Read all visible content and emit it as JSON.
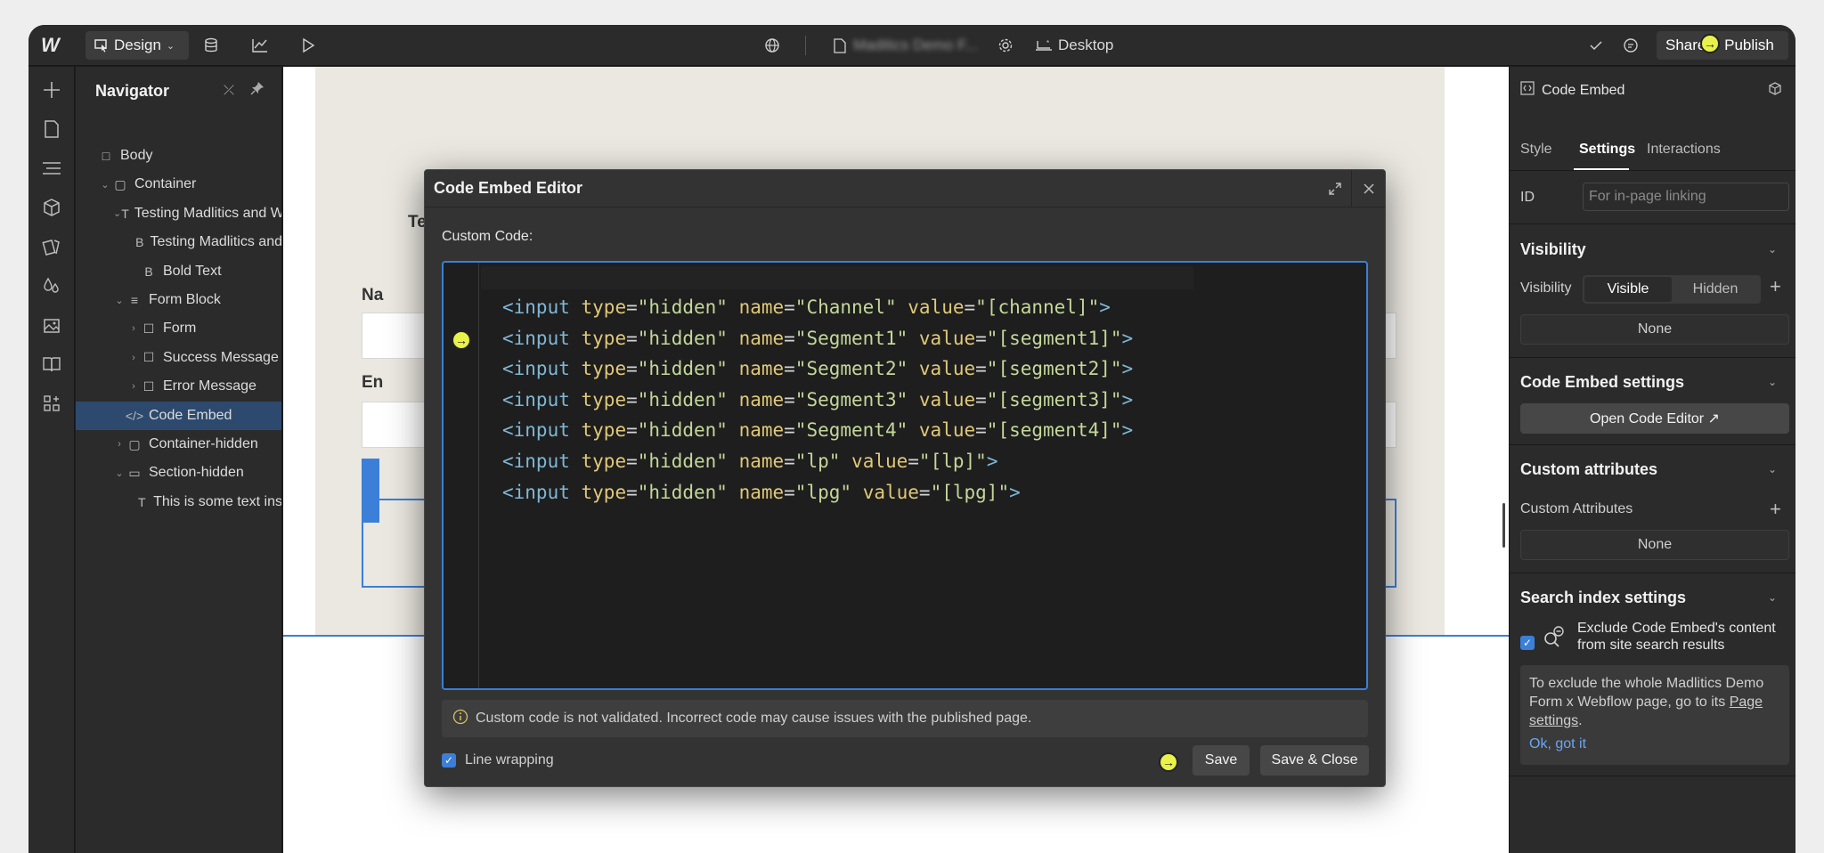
{
  "topbar": {
    "logo": "W",
    "mode_label": "Design",
    "page_name": "Maditics Demo F...",
    "device_label": "Desktop",
    "share_label": "Share",
    "publish_label": "Publish"
  },
  "navigator": {
    "title": "Navigator",
    "items": [
      {
        "label": "Body",
        "icon": "□",
        "indent": 0,
        "chevron": ""
      },
      {
        "label": "Container",
        "icon": "▢",
        "indent": 1,
        "chevron": "⌄"
      },
      {
        "label": "Testing Madlitics and W",
        "icon": "T",
        "indent": 2,
        "chevron": "⌄"
      },
      {
        "label": "Testing Madlitics and",
        "icon": "B",
        "indent": 3,
        "chevron": ""
      },
      {
        "label": "Bold Text",
        "icon": "B",
        "indent": 3,
        "chevron": ""
      },
      {
        "label": "Form Block",
        "icon": "≡",
        "indent": 2,
        "chevron": "⌄"
      },
      {
        "label": "Form",
        "icon": "☐",
        "indent": 3,
        "chevron": "›"
      },
      {
        "label": "Success Message",
        "icon": "☐",
        "indent": 3,
        "chevron": "›"
      },
      {
        "label": "Error Message",
        "icon": "☐",
        "indent": 3,
        "chevron": "›"
      },
      {
        "label": "Code Embed",
        "icon": "</>",
        "indent": 2,
        "chevron": ""
      },
      {
        "label": "Container-hidden",
        "icon": "▢",
        "indent": 2,
        "chevron": "›"
      },
      {
        "label": "Section-hidden",
        "icon": "▭",
        "indent": 2,
        "chevron": "⌄"
      },
      {
        "label": "This is some text ins",
        "icon": "T",
        "indent": 3,
        "chevron": ""
      }
    ]
  },
  "canvas": {
    "label_1": "Te",
    "label_2": "Na",
    "label_3": "En"
  },
  "modal": {
    "title": "Code Embed Editor",
    "custom_code_label": "Custom Code:",
    "code_lines": [
      {
        "tag": "<input",
        "name": "Channel",
        "value": "[channel]"
      },
      {
        "tag": "<input",
        "name": "Segment1",
        "value": "[segment1]"
      },
      {
        "tag": "<input",
        "name": "Segment2",
        "value": "[segment2]"
      },
      {
        "tag": "<input",
        "name": "Segment3",
        "value": "[segment3]"
      },
      {
        "tag": "<input",
        "name": "Segment4",
        "value": "[segment4]"
      },
      {
        "tag": "<input",
        "name": "lp",
        "value": "[lp]"
      },
      {
        "tag": "<input",
        "name": "lpg",
        "value": "[lpg]"
      }
    ],
    "type_value": "hidden",
    "warning": "Custom code is not validated. Incorrect code may cause issues with the published page.",
    "line_wrapping_label": "Line wrapping",
    "save_label": "Save",
    "save_close_label": "Save & Close"
  },
  "rightpanel": {
    "element_label": "Code Embed",
    "tabs": [
      "Style",
      "Settings",
      "Interactions"
    ],
    "active_tab": "Settings",
    "id_label": "ID",
    "id_placeholder": "For in-page linking",
    "visibility_title": "Visibility",
    "visibility_label": "Visibility",
    "visible_label": "Visible",
    "hidden_label": "Hidden",
    "visibility_none": "None",
    "code_embed_settings_title": "Code Embed settings",
    "open_code_editor_label": "Open Code Editor ↗",
    "custom_attributes_title": "Custom attributes",
    "custom_attributes_label": "Custom Attributes",
    "custom_attributes_none": "None",
    "search_index_title": "Search index settings",
    "exclude_label_line1": "Exclude Code Embed's content",
    "exclude_label_line2": "from site search results",
    "info_text_1": "To exclude the whole Madlitics Demo",
    "info_text_2": "Form x Webflow page, go to its",
    "info_link_1": "Page",
    "info_link_2": "settings",
    "info_period": ".",
    "ok_label": "Ok, got it"
  },
  "colors": {
    "accent": "#3b7fd8",
    "cursor": "#e8f24a"
  }
}
